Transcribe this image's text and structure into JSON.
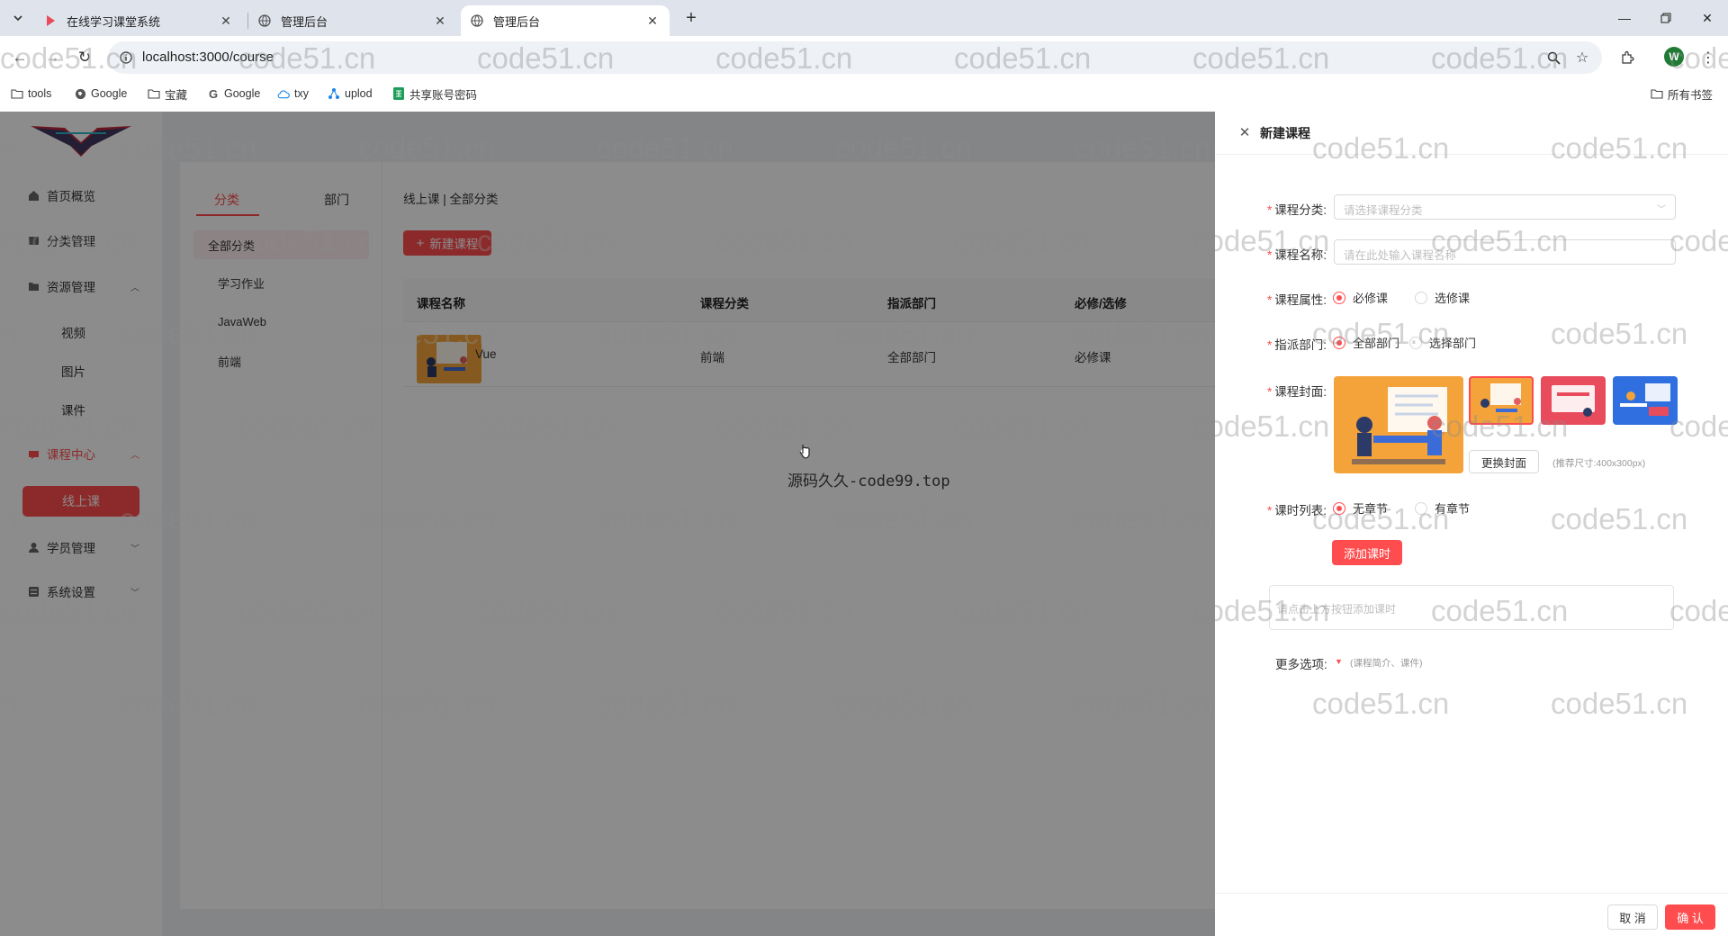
{
  "browser": {
    "tabs": [
      {
        "title": "在线学习课堂系统",
        "active": false
      },
      {
        "title": "管理后台",
        "active": false
      },
      {
        "title": "管理后台",
        "active": true
      }
    ],
    "url": "localhost:3000/course",
    "profile_initial": "W",
    "bookmarks": [
      "tools",
      "Google",
      "宝藏",
      "Google",
      "txy",
      "uplod",
      "共享账号密码"
    ],
    "all_bookmarks": "所有书签"
  },
  "sidebar": {
    "items": [
      {
        "label": "首页概览",
        "icon": "home-icon"
      },
      {
        "label": "分类管理",
        "icon": "category-icon"
      },
      {
        "label": "资源管理",
        "icon": "folder-icon"
      },
      {
        "label": "课程中心",
        "icon": "course-icon"
      },
      {
        "label": "学员管理",
        "icon": "user-icon"
      },
      {
        "label": "系统设置",
        "icon": "settings-icon"
      }
    ],
    "resource_sub": [
      "视频",
      "图片",
      "课件"
    ],
    "course_sub_active": "线上课"
  },
  "category_panel": {
    "tabs": [
      "分类",
      "部门"
    ],
    "items": [
      "全部分类",
      "学习作业",
      "JavaWeb",
      "前端"
    ]
  },
  "main": {
    "breadcrumb": "线上课 | 全部分类",
    "new_course_button": "新建课程",
    "columns": [
      "课程名称",
      "课程分类",
      "指派部门",
      "必修/选修"
    ],
    "rows": [
      {
        "name": "Vue",
        "category": "前端",
        "department": "全部部门",
        "type": "必修课"
      }
    ]
  },
  "center_watermark": "源码久久-code99.top",
  "watermark_text": "code51.cn",
  "drawer": {
    "title": "新建课程",
    "category_label": "课程分类:",
    "category_placeholder": "请选择课程分类",
    "name_label": "课程名称:",
    "name_placeholder": "请在此处输入课程名称",
    "attr_label": "课程属性:",
    "attr_options": [
      "必修课",
      "选修课"
    ],
    "dept_label": "指派部门:",
    "dept_options": [
      "全部部门",
      "选择部门"
    ],
    "cover_label": "课程封面:",
    "change_cover_button": "更换封面",
    "cover_hint": "(推荐尺寸:400x300px)",
    "lesson_label": "课时列表:",
    "lesson_options": [
      "无章节",
      "有章节"
    ],
    "add_lesson_button": "添加课时",
    "lesson_placeholder": "请点击上方按钮添加课时",
    "more_label": "更多选项:",
    "more_hint": "(课程简介、课件)",
    "cancel_button": "取 消",
    "confirm_button": "确 认"
  },
  "colors": {
    "accent": "#ff4d4f",
    "mask": "rgba(0,0,0,0.45)"
  }
}
